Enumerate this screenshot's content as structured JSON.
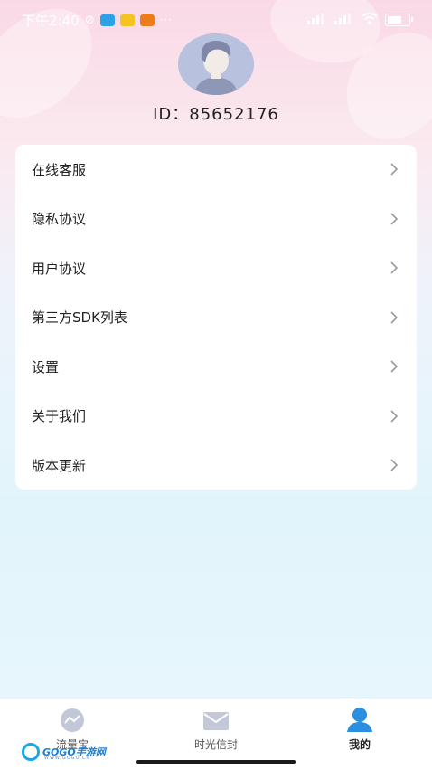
{
  "status_bar": {
    "time": "下午2:40",
    "dots": "···"
  },
  "profile": {
    "id_text": "ID：85652176"
  },
  "menu": {
    "items": [
      {
        "label": "在线客服"
      },
      {
        "label": "隐私协议"
      },
      {
        "label": "用户协议"
      },
      {
        "label": "第三方SDK列表"
      },
      {
        "label": "设置"
      },
      {
        "label": "关于我们"
      },
      {
        "label": "版本更新"
      }
    ]
  },
  "bottom_nav": {
    "tabs": [
      {
        "label": "流量宝",
        "icon": "chart-icon",
        "active": false
      },
      {
        "label": "时光信封",
        "icon": "envelope-icon",
        "active": false
      },
      {
        "label": "我的",
        "icon": "person-icon",
        "active": true
      }
    ]
  },
  "watermark": {
    "text": "GOGO手游网",
    "sub": "WWW.GOGO.CN"
  },
  "colors": {
    "accent_blue": "#2a8fe0",
    "inactive_icon": "#c3c8d8",
    "avatar_bg": "#b8c1dd"
  }
}
